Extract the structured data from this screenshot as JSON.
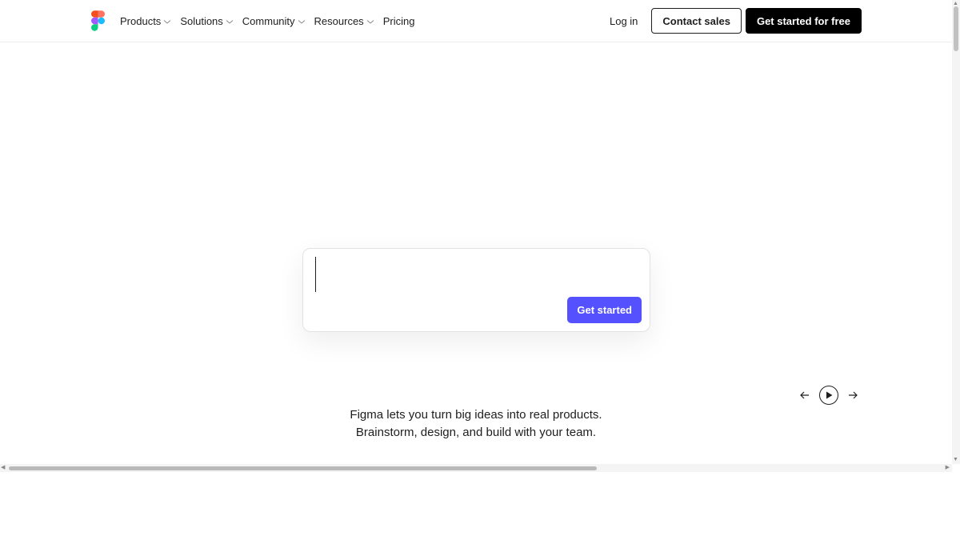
{
  "header": {
    "logo_icon": "figma-logo-icon",
    "nav": [
      {
        "label": "Products",
        "has_dropdown": true
      },
      {
        "label": "Solutions",
        "has_dropdown": true
      },
      {
        "label": "Community",
        "has_dropdown": true
      },
      {
        "label": "Resources",
        "has_dropdown": true
      },
      {
        "label": "Pricing",
        "has_dropdown": false
      }
    ],
    "login_label": "Log in",
    "contact_label": "Contact sales",
    "signup_label": "Get started for free"
  },
  "prompt": {
    "input_value": "",
    "submit_label": "Get started"
  },
  "carousel": {
    "prev_icon": "arrow-left-icon",
    "play_icon": "play-icon",
    "next_icon": "arrow-right-icon"
  },
  "tagline": {
    "line1": "Figma lets you turn big ideas into real products.",
    "line2": "Brainstorm, design, and build with your team."
  },
  "colors": {
    "primary": "#5551ff",
    "text": "#1e1e1e",
    "logo_red": "#f24e1e",
    "logo_orange": "#ff7262",
    "logo_purple": "#a259ff",
    "logo_blue": "#1abcfe",
    "logo_green": "#0acf83"
  }
}
